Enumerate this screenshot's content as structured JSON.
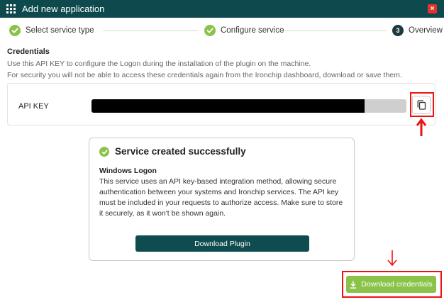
{
  "window": {
    "title": "Add new application",
    "close_label": "×"
  },
  "stepper": {
    "steps": [
      {
        "label": "Select service type",
        "state": "done"
      },
      {
        "label": "Configure service",
        "state": "done"
      },
      {
        "label": "Overview",
        "state": "current",
        "number": "3"
      }
    ]
  },
  "credentials": {
    "heading": "Credentials",
    "instruction": "Use this API KEY to configure the Logon during the installation of the plugin on the machine.",
    "security_note": "For security you will not be able to access these credentials again from the Ironchip dashboard, download or save them.",
    "api_key_label": "API KEY",
    "copy_icon": "copy-icon"
  },
  "success": {
    "title": "Service created successfully",
    "service_name": "Windows Logon",
    "description": "This service uses an API key-based integration method, allowing secure authentication between your systems and Ironchip services. The API key must be included in your requests to authorize access. Make sure to store it securely, as it won't be shown again.",
    "download_plugin_label": "Download Plugin"
  },
  "footer": {
    "download_credentials_label": "Download credentials",
    "download_icon": "download-icon"
  },
  "colors": {
    "header": "#0e4a4d",
    "accent_green": "#8bc34a",
    "primary_button": "#0f4c4f",
    "annotation_red": "#e11111"
  }
}
